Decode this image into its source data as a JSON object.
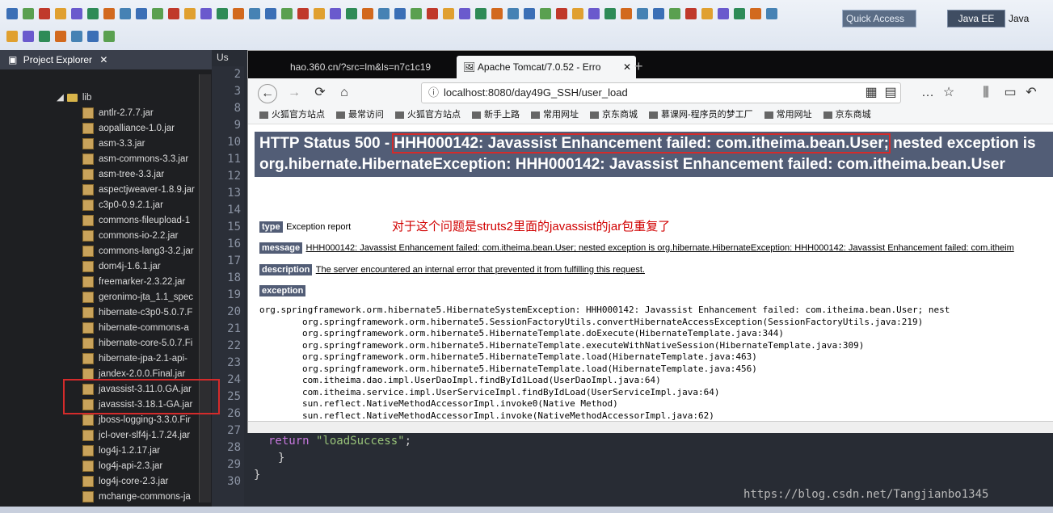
{
  "ide": {
    "quick_access": "Quick Access",
    "perspective": "Java EE",
    "perspective2": "Java"
  },
  "project_explorer": {
    "title": "Project Explorer",
    "folder": "lib",
    "jars": [
      "antlr-2.7.7.jar",
      "aopalliance-1.0.jar",
      "asm-3.3.jar",
      "asm-commons-3.3.jar",
      "asm-tree-3.3.jar",
      "aspectjweaver-1.8.9.jar",
      "c3p0-0.9.2.1.jar",
      "commons-fileupload-1",
      "commons-io-2.2.jar",
      "commons-lang3-3.2.jar",
      "dom4j-1.6.1.jar",
      "freemarker-2.3.22.jar",
      "geronimo-jta_1.1_spec",
      "hibernate-c3p0-5.0.7.F",
      "hibernate-commons-a",
      "hibernate-core-5.0.7.Fi",
      "hibernate-jpa-2.1-api-",
      "jandex-2.0.0.Final.jar",
      "javassist-3.11.0.GA.jar",
      "javassist-3.18.1-GA.jar",
      "jboss-logging-3.3.0.Fir",
      "jcl-over-slf4j-1.7.24.jar",
      "log4j-1.2.17.jar",
      "log4j-api-2.3.jar",
      "log4j-core-2.3.jar",
      "mchange-commons-ja"
    ]
  },
  "editor": {
    "tab": "Us",
    "line_numbers": [
      "2",
      "3",
      "8",
      "9",
      "10",
      "11",
      "12",
      "13",
      "14",
      "15",
      "16",
      "17",
      "18",
      "19",
      "20",
      "21",
      "22",
      "23",
      "24",
      "25",
      "26",
      "27",
      "28",
      "29",
      "30"
    ],
    "code_lines": [
      {
        "ln": "27",
        "text": "    return \"loadSuccess\";"
      },
      {
        "ln": "28",
        "text": "  }"
      },
      {
        "ln": "29",
        "text": "}"
      }
    ]
  },
  "browser": {
    "tab1": "hao.360.cn/?src=lm&ls=n7c1c19",
    "tab2": "Apache Tomcat/7.0.52 - Erro",
    "url": "localhost:8080/day49G_SSH/user_load",
    "bookmarks": [
      "火狐官方站点",
      "最常访问",
      "火狐官方站点",
      "新手上路",
      "常用网址",
      "京东商城",
      "慕课网-程序员的梦工厂",
      "常用网址",
      "京东商城"
    ],
    "page": {
      "heading_prefix": "HTTP Status 500 - ",
      "heading_boxed": "HHH000142: Javassist Enhancement failed: com.itheima.bean.User;",
      "heading_rest": " nested exception is org.hibernate.HibernateException: HHH000142: Javassist Enhancement failed: com.itheima.bean.User",
      "type_label": "type",
      "type_value": "Exception report",
      "annotation": "对于这个问题是struts2里面的javassist的jar包重复了",
      "message_label": "message",
      "message_value": "HHH000142: Javassist Enhancement failed: com.itheima.bean.User; nested exception is org.hibernate.HibernateException: HHH000142: Javassist Enhancement failed: com.itheim",
      "description_label": "description",
      "description_value": "The server encountered an internal error that prevented it from fulfilling this request.",
      "exception_label": "exception",
      "trace": [
        "org.springframework.orm.hibernate5.HibernateSystemException: HHH000142: Javassist Enhancement failed: com.itheima.bean.User; nest",
        "        org.springframework.orm.hibernate5.SessionFactoryUtils.convertHibernateAccessException(SessionFactoryUtils.java:219)",
        "        org.springframework.orm.hibernate5.HibernateTemplate.doExecute(HibernateTemplate.java:344)",
        "        org.springframework.orm.hibernate5.HibernateTemplate.executeWithNativeSession(HibernateTemplate.java:309)",
        "        org.springframework.orm.hibernate5.HibernateTemplate.load(HibernateTemplate.java:463)",
        "        org.springframework.orm.hibernate5.HibernateTemplate.load(HibernateTemplate.java:456)",
        "        com.itheima.dao.impl.UserDaoImpl.findById1Load(UserDaoImpl.java:64)",
        "        com.itheima.service.impl.UserServiceImpl.findByIdLoad(UserServiceImpl.java:64)",
        "        sun.reflect.NativeMethodAccessorImpl.invoke0(Native Method)",
        "        sun.reflect.NativeMethodAccessorImpl.invoke(NativeMethodAccessorImpl.java:62)"
      ]
    }
  },
  "watermark": "https://blog.csdn.net/Tangjianbo1345"
}
